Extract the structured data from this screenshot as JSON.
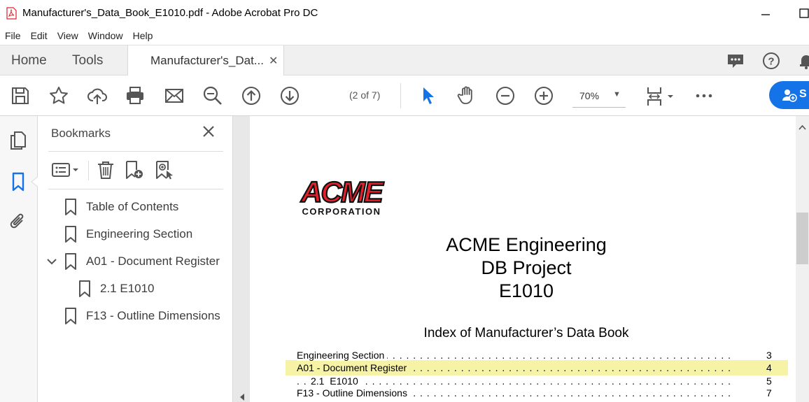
{
  "window": {
    "title": "Manufacturer's_Data_Book_E1010.pdf - Adobe Acrobat Pro DC"
  },
  "menu": [
    "File",
    "Edit",
    "View",
    "Window",
    "Help"
  ],
  "tabs": {
    "home": "Home",
    "tools": "Tools",
    "document": "Manufacturer's_Dat..."
  },
  "toolbar": {
    "page_count": "(2 of 7)",
    "zoom": "70%",
    "share_label": "S"
  },
  "bookmarks": {
    "title": "Bookmarks",
    "items": [
      {
        "label": "Table of Contents"
      },
      {
        "label": "Engineering Section"
      },
      {
        "label": "A01 - Document Register"
      },
      {
        "label": "2.1 E1010"
      },
      {
        "label": "F13 - Outline Dimensions"
      }
    ]
  },
  "document": {
    "logo_text": "ACME",
    "logo_sub": "CORPORATION",
    "heading_lines": [
      "ACME Engineering",
      "DB Project",
      "E1010"
    ],
    "index_title": "Index of Manufacturer’s Data Book",
    "index": [
      {
        "label": "Engineering Section",
        "page": "3"
      },
      {
        "label": "A01 - Document Register",
        "page": "4"
      },
      {
        "label": "2.1  E1010",
        "page": "5"
      },
      {
        "label": "F13 - Outline Dimensions",
        "page": "7"
      }
    ]
  },
  "colors": {
    "accent": "#1473e6",
    "highlight": "#f7f3a6",
    "logo_red": "#e4202a"
  }
}
